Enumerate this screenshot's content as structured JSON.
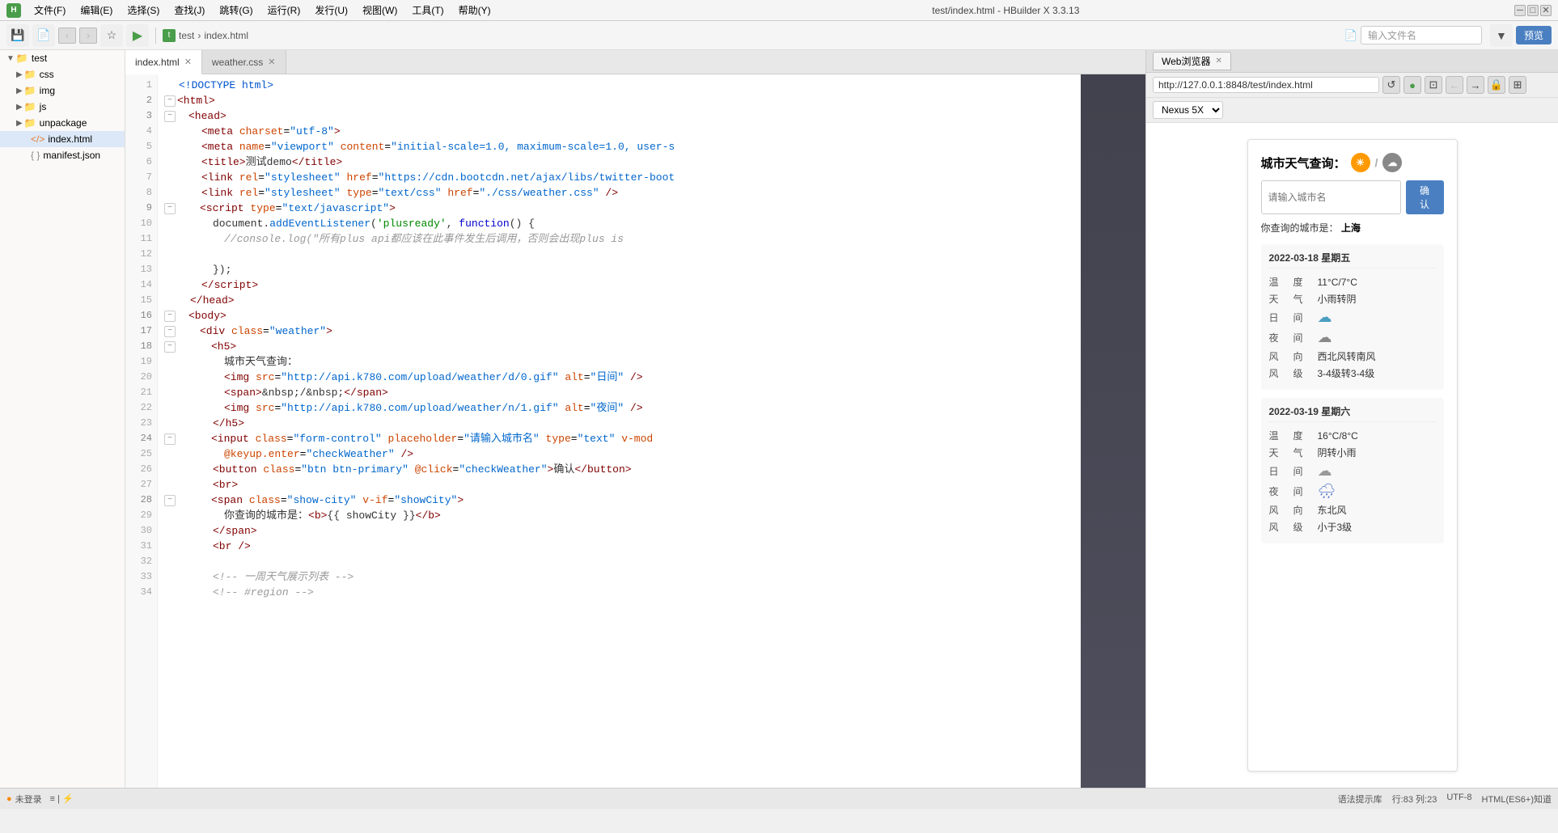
{
  "app": {
    "title": "test/index.html - HBuilder X 3.3.13"
  },
  "menu": {
    "items": [
      "文件(F)",
      "编辑(E)",
      "选择(S)",
      "查找(J)",
      "跳转(G)",
      "运行(R)",
      "发行(U)",
      "视图(W)",
      "工具(T)",
      "帮助(Y)"
    ]
  },
  "toolbar": {
    "breadcrumb": [
      "test",
      "index.html"
    ],
    "file_placeholder": "输入文件名",
    "preview_label": "预览",
    "filter_icon": "▼"
  },
  "sidebar": {
    "root": "test",
    "items": [
      {
        "name": "css",
        "type": "folder",
        "indent": 1
      },
      {
        "name": "img",
        "type": "folder",
        "indent": 1
      },
      {
        "name": "js",
        "type": "folder",
        "indent": 1
      },
      {
        "name": "unpackage",
        "type": "folder",
        "indent": 1
      },
      {
        "name": "index.html",
        "type": "html",
        "indent": 1
      },
      {
        "name": "manifest.json",
        "type": "json",
        "indent": 1
      }
    ]
  },
  "editor": {
    "tabs": [
      {
        "name": "index.html",
        "active": true
      },
      {
        "name": "weather.css",
        "active": false
      }
    ],
    "lines": [
      {
        "num": 1,
        "fold": false,
        "text_html": "<!DOCTYPE html>"
      },
      {
        "num": 2,
        "fold": true,
        "text_html": "&lt;html&gt;"
      },
      {
        "num": 3,
        "fold": true,
        "text_html": "    &lt;head&gt;"
      },
      {
        "num": 4,
        "fold": false,
        "text_html": "        &lt;meta charset=\"utf-8\"&gt;"
      },
      {
        "num": 5,
        "fold": false,
        "text_html": "        &lt;meta name=\"viewport\" content=\"initial-scale=1.0, maximum-scale=1.0, user-s"
      },
      {
        "num": 6,
        "fold": false,
        "text_html": "        &lt;title&gt;测试demo&lt;/title&gt;"
      },
      {
        "num": 7,
        "fold": false,
        "text_html": "        &lt;link rel=\"stylesheet\" href=\"https://cdn.bootcdn.net/ajax/libs/twitter-boot"
      },
      {
        "num": 8,
        "fold": false,
        "text_html": "        &lt;link rel=\"stylesheet\" type=\"text/css\" href=\"./css/weather.css\" /&gt;"
      },
      {
        "num": 9,
        "fold": true,
        "text_html": "        &lt;script type=\"text/javascript\"&gt;"
      },
      {
        "num": 10,
        "fold": false,
        "text_html": "            document.addEventListener('plusready', function() {"
      },
      {
        "num": 11,
        "fold": false,
        "text_html": "                //console.log(\"所有plus api都应该在此事件发生后调用，否则会出现plus is"
      },
      {
        "num": 12,
        "fold": false,
        "text_html": ""
      },
      {
        "num": 13,
        "fold": false,
        "text_html": "            });"
      },
      {
        "num": 14,
        "fold": false,
        "text_html": "        &lt;/script&gt;"
      },
      {
        "num": 15,
        "fold": false,
        "text_html": "    &lt;/head&gt;"
      },
      {
        "num": 16,
        "fold": true,
        "text_html": "    &lt;body&gt;"
      },
      {
        "num": 17,
        "fold": true,
        "text_html": "        &lt;div class=\"weather\"&gt;"
      },
      {
        "num": 18,
        "fold": true,
        "text_html": "            &lt;h5&gt;"
      },
      {
        "num": 19,
        "fold": false,
        "text_html": "                城市天气查询："
      },
      {
        "num": 20,
        "fold": false,
        "text_html": "                &lt;img src=\"http://api.k780.com/upload/weather/d/0.gif\" alt=\"日间\" /&gt;"
      },
      {
        "num": 21,
        "fold": false,
        "text_html": "                &lt;span&gt;&amp;nbsp;/&amp;nbsp;&lt;/span&gt;"
      },
      {
        "num": 22,
        "fold": false,
        "text_html": "                &lt;img src=\"http://api.k780.com/upload/weather/n/1.gif\" alt=\"夜间\" /&gt;"
      },
      {
        "num": 23,
        "fold": false,
        "text_html": "            &lt;/h5&gt;"
      },
      {
        "num": 24,
        "fold": true,
        "text_html": "            &lt;input class=\"form-control\" placeholder=\"请输入城市名\" type=\"text\" v-mod"
      },
      {
        "num": 25,
        "fold": false,
        "text_html": "                @keyup.enter=\"checkWeather\" /&gt;"
      },
      {
        "num": 26,
        "fold": false,
        "text_html": "            &lt;button class=\"btn btn-primary\" @click=\"checkWeather\"&gt;确认&lt;/button&gt;"
      },
      {
        "num": 27,
        "fold": false,
        "text_html": "            &lt;br&gt;"
      },
      {
        "num": 28,
        "fold": true,
        "text_html": "            &lt;span class=\"show-city\" v-if=\"showCity\"&gt;"
      },
      {
        "num": 29,
        "fold": false,
        "text_html": "                你查询的城市是：&lt;b&gt;{{ showCity }}&lt;/b&gt;"
      },
      {
        "num": 30,
        "fold": false,
        "text_html": "            &lt;/span&gt;"
      },
      {
        "num": 31,
        "fold": false,
        "text_html": "            &lt;br /&gt;"
      },
      {
        "num": 32,
        "fold": false,
        "text_html": ""
      },
      {
        "num": 33,
        "fold": false,
        "text_html": "            &lt;!-- 一周天气展示列表 --&gt;"
      },
      {
        "num": 34,
        "fold": false,
        "text_html": "            &lt;!-- #region --&gt;"
      }
    ]
  },
  "browser": {
    "tab_label": "Web浏览器",
    "url": "http://127.0.0.1:8848/test/index.html",
    "device": "Nexus 5X",
    "weather_title": "城市天气查询：",
    "input_placeholder": "请输入城市名",
    "confirm_btn": "确认",
    "city_query_label": "你查询的城市是：",
    "city_name": "上海",
    "day1": {
      "date": "2022-03-18 星期五",
      "temp_label": "温　度",
      "temp": "11°C/7°C",
      "weather_label": "天　气",
      "weather": "小雨转阴",
      "day_label": "日　间",
      "night_label": "夜　间",
      "wind_dir_label": "风　向",
      "wind_dir": "西北风转南风",
      "wind_lvl_label": "风　级",
      "wind_lvl": "3-4级转3-4级"
    },
    "day2": {
      "date": "2022-03-19 星期六",
      "temp_label": "温　度",
      "temp": "16°C/8°C",
      "weather_label": "天　气",
      "weather": "阴转小雨",
      "day_label": "日　间",
      "night_label": "夜　间",
      "wind_dir_label": "风　向",
      "wind_dir": "东北风",
      "wind_lvl_label": "风　级",
      "wind_lvl": "小于3级"
    }
  },
  "statusbar": {
    "hint": "语法提示库",
    "cursor": "行:83 列:23",
    "encoding": "UTF-8",
    "syntax": "HTML(ES6+)知道",
    "not_logged": "未登录"
  }
}
